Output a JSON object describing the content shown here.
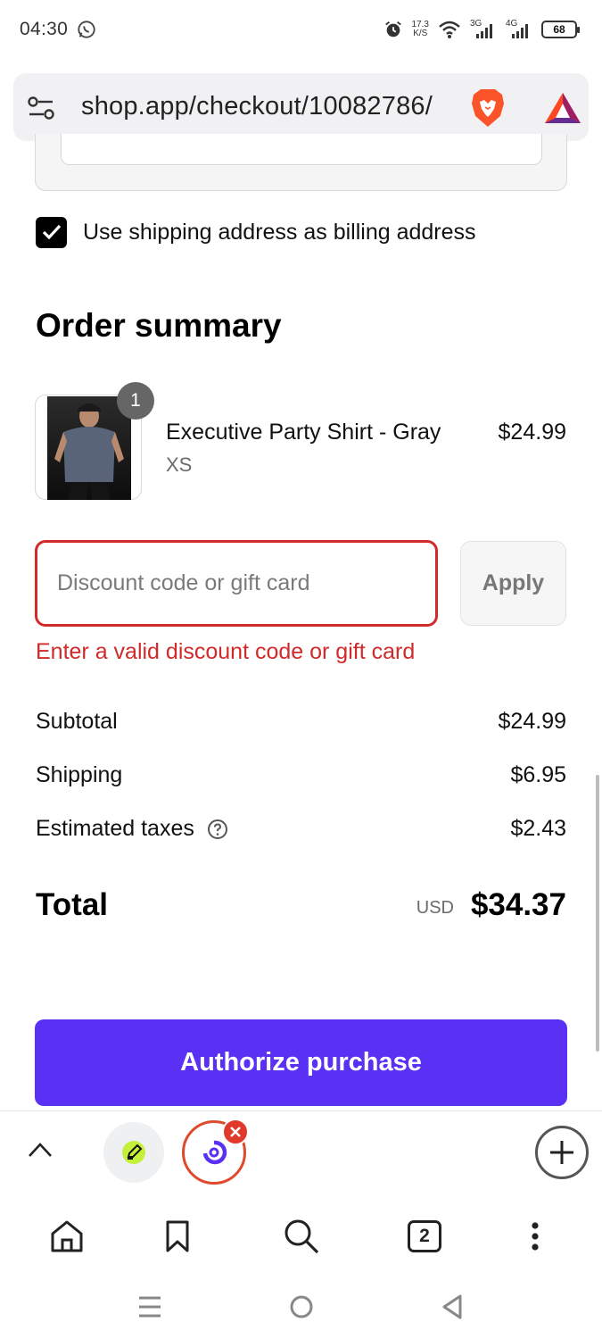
{
  "status_bar": {
    "time": "04:30",
    "net_speed_value": "17.3",
    "net_speed_unit": "K/S",
    "net_3g": "3G",
    "net_4g": "4G",
    "battery": "68"
  },
  "browser": {
    "url": "shop.app/checkout/10082786/",
    "icons": [
      "tune-icon",
      "brave-lion-icon",
      "bat-rewards-icon"
    ]
  },
  "billing": {
    "checkbox_checked": true,
    "label": "Use shipping address as billing address"
  },
  "order_summary": {
    "title": "Order summary",
    "item": {
      "quantity": "1",
      "name": "Executive Party Shirt - Gray",
      "variant": "XS",
      "price": "$24.99"
    }
  },
  "discount": {
    "placeholder": "Discount code or gift card",
    "value": "",
    "apply_label": "Apply",
    "error": "Enter a valid discount code or gift card"
  },
  "totals": {
    "subtotal_label": "Subtotal",
    "subtotal_value": "$24.99",
    "shipping_label": "Shipping",
    "shipping_value": "$6.95",
    "taxes_label": "Estimated taxes",
    "taxes_value": "$2.43",
    "total_label": "Total",
    "currency": "USD",
    "total_value": "$34.37"
  },
  "cta": {
    "label": "Authorize purchase",
    "color": "#5a31f4"
  },
  "bottom_bar": {
    "tab_count": "2"
  },
  "colors": {
    "error": "#d02a2a",
    "accent": "#5a31f4"
  }
}
